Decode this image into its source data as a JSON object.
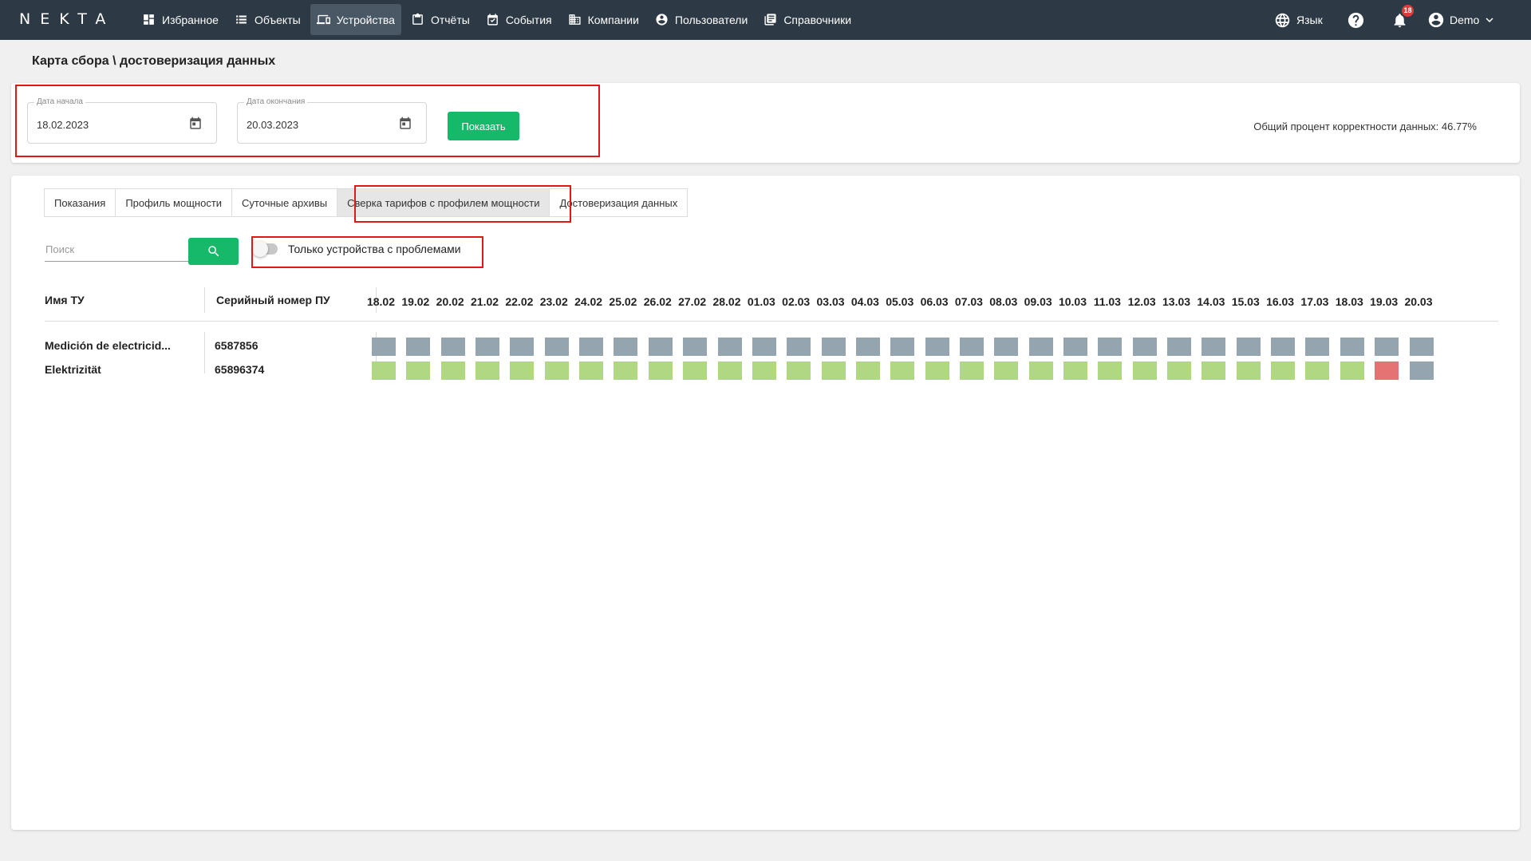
{
  "app": {
    "logo": "NEKTA"
  },
  "nav": [
    {
      "label": "Избранное",
      "icon": "dashboard-icon"
    },
    {
      "label": "Объекты",
      "icon": "list-icon"
    },
    {
      "label": "Устройства",
      "icon": "devices-icon",
      "active": true
    },
    {
      "label": "Отчёты",
      "icon": "clipboard-icon"
    },
    {
      "label": "События",
      "icon": "event-icon"
    },
    {
      "label": "Компании",
      "icon": "building-icon"
    },
    {
      "label": "Пользователи",
      "icon": "user-icon"
    },
    {
      "label": "Справочники",
      "icon": "book-icon"
    }
  ],
  "topright": {
    "language_label": "Язык",
    "notifications_count": "18",
    "user_name": "Demo"
  },
  "page": {
    "title": "Карта сбора \\ достоверизация данных"
  },
  "filters": {
    "start_label": "Дата начала",
    "start_value": "18.02.2023",
    "end_label": "Дата окончания",
    "end_value": "20.03.2023",
    "show_button": "Показать",
    "total_correctness": "Общий процент корректности данных: 46.77%"
  },
  "tabs": [
    {
      "label": "Показания"
    },
    {
      "label": "Профиль мощности"
    },
    {
      "label": "Суточные архивы"
    },
    {
      "label": "Сверка тарифов с профилем мощности",
      "active": true
    },
    {
      "label": "Достоверизация данных"
    }
  ],
  "search": {
    "placeholder": "Поиск"
  },
  "toggle": {
    "label": "Только устройства с проблемами",
    "on": false
  },
  "table": {
    "col_name": "Имя ТУ",
    "col_serial": "Серийный номер ПУ",
    "dates": [
      "18.02",
      "19.02",
      "20.02",
      "21.02",
      "22.02",
      "23.02",
      "24.02",
      "25.02",
      "26.02",
      "27.02",
      "28.02",
      "01.03",
      "02.03",
      "03.03",
      "04.03",
      "05.03",
      "06.03",
      "07.03",
      "08.03",
      "09.03",
      "10.03",
      "11.03",
      "12.03",
      "13.03",
      "14.03",
      "15.03",
      "16.03",
      "17.03",
      "18.03",
      "19.03",
      "20.03"
    ],
    "rows": [
      {
        "name": "Medición de electricid...",
        "serial": "6587856",
        "statuses": [
          "gray",
          "gray",
          "gray",
          "gray",
          "gray",
          "gray",
          "gray",
          "gray",
          "gray",
          "gray",
          "gray",
          "gray",
          "gray",
          "gray",
          "gray",
          "gray",
          "gray",
          "gray",
          "gray",
          "gray",
          "gray",
          "gray",
          "gray",
          "gray",
          "gray",
          "gray",
          "gray",
          "gray",
          "gray",
          "gray",
          "gray"
        ]
      },
      {
        "name": "Elektrizität",
        "serial": "65896374",
        "statuses": [
          "green",
          "green",
          "green",
          "green",
          "green",
          "green",
          "green",
          "green",
          "green",
          "green",
          "green",
          "green",
          "green",
          "green",
          "green",
          "green",
          "green",
          "green",
          "green",
          "green",
          "green",
          "green",
          "green",
          "green",
          "green",
          "green",
          "green",
          "green",
          "green",
          "red",
          "gray"
        ]
      }
    ]
  },
  "colors": {
    "nav_bg": "#2d3a45",
    "accent_green": "#16b86a",
    "status_gray": "#95a5af",
    "status_green": "#b0d883",
    "status_red": "#e57373",
    "highlight_red": "#e01818"
  }
}
